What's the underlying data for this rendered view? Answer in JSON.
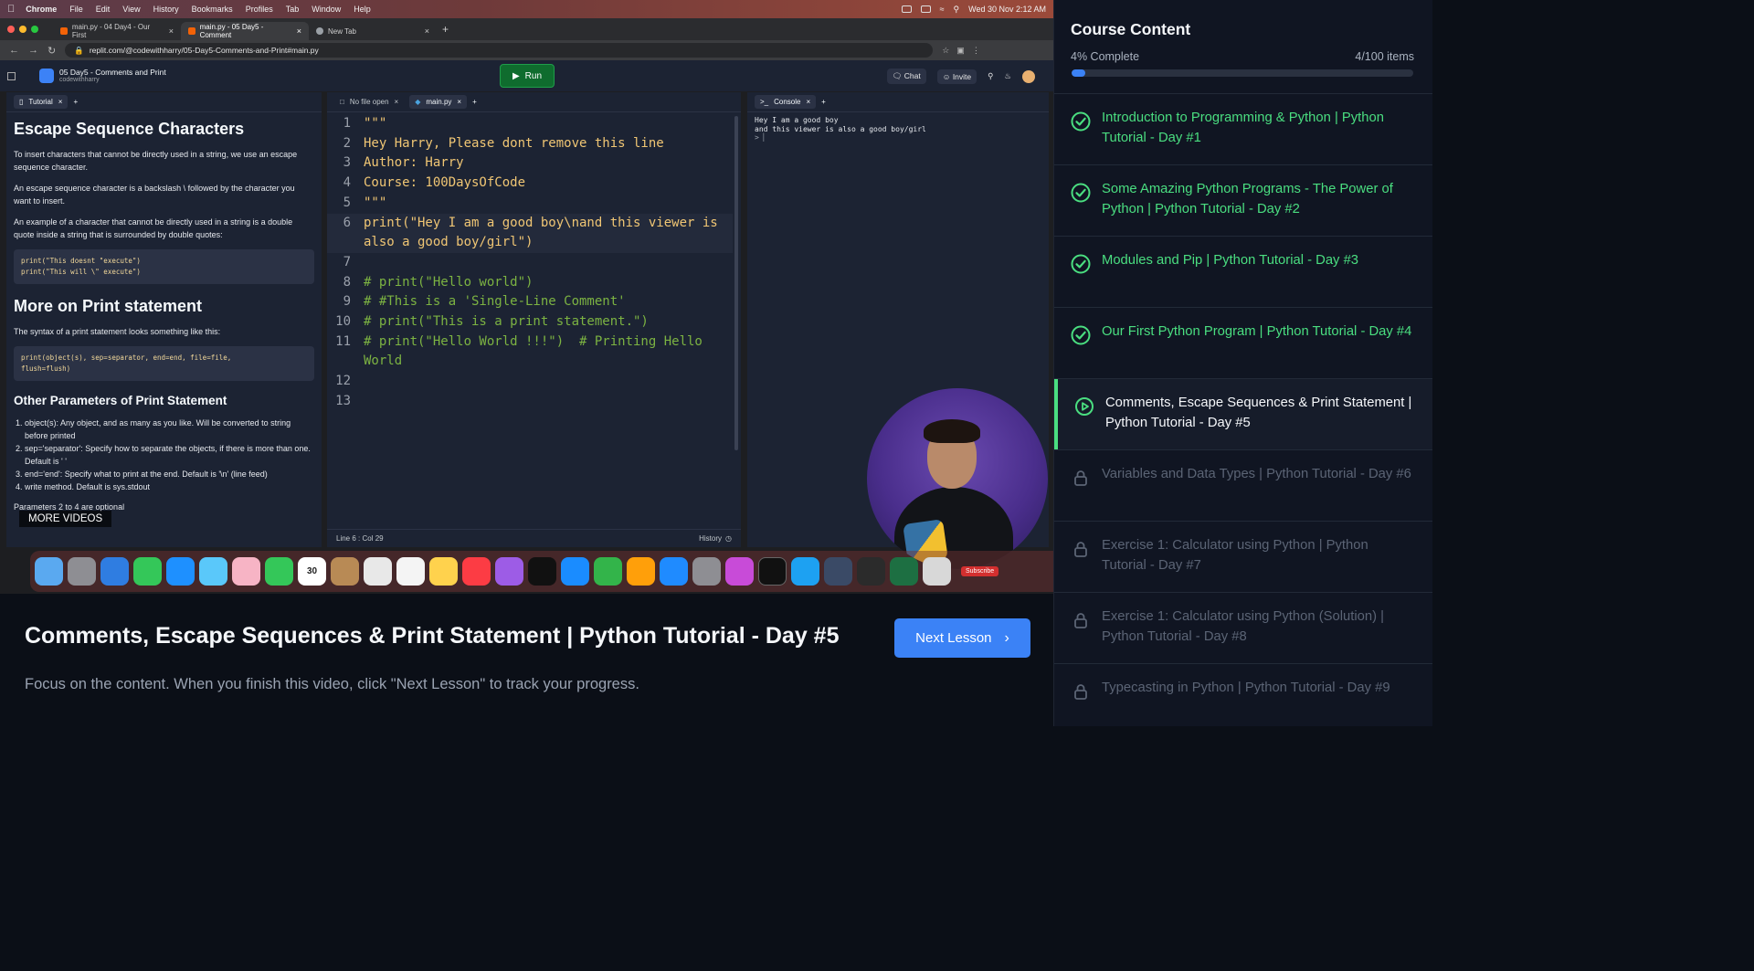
{
  "video": {
    "mac_menu": {
      "items": [
        "Chrome",
        "File",
        "Edit",
        "View",
        "History",
        "Bookmarks",
        "Profiles",
        "Tab",
        "Window",
        "Help"
      ],
      "clock": "Wed 30 Nov  2:12 AM"
    },
    "browser": {
      "tabs": [
        {
          "label": "main.py - 04 Day4 - Our First"
        },
        {
          "label": "main.py - 05 Day5 - Comment"
        },
        {
          "label": "New Tab"
        }
      ],
      "url": "replit.com/@codewithharry/05-Day5-Comments-and-Print#main.py"
    },
    "replit": {
      "repl_title": "05 Day5 - Comments and Print",
      "repl_owner": "codewithharry",
      "run_label": "Run",
      "chat_label": "Chat",
      "invite_label": "Invite",
      "tutorial_tab": "Tutorial",
      "no_file_tab": "No file open",
      "main_tab": "main.py",
      "console_tab": "Console",
      "tutorial": {
        "h_escape": "Escape Sequence Characters",
        "p1": "To insert characters that cannot be directly used in a string, we use an escape sequence character.",
        "p2": "An escape sequence character is a backslash \\ followed by the character you want to insert.",
        "p3": "An example of a character that cannot be directly used in a string is a double quote inside a string that is surrounded by double quotes:",
        "code1_l1": "print(\"This doesnt \"execute\")",
        "code1_l2": "print(\"This will \\\" execute\")",
        "h_print": "More on Print statement",
        "p4": "The syntax of a print statement looks something like this:",
        "code2_l1": "print(object(s), sep=separator, end=end, file=file,",
        "code2_l2": "flush=flush)",
        "h_other": "Other Parameters of Print Statement",
        "li1": "object(s): Any object, and as many as you like. Will be converted to string before printed",
        "li2": "sep='separator': Specify how to separate the objects, if there is more than one. Default is ' '",
        "li3": "end='end': Specify what to print at the end. Default is '\\n' (line feed)",
        "li4": "write method. Default is sys.stdout",
        "p5": "Parameters 2 to 4 are optional",
        "more_videos": "MORE VIDEOS"
      },
      "code_lines": [
        {
          "n": "1",
          "t": "\"\"\""
        },
        {
          "n": "2",
          "t": "Hey Harry, Please dont remove this line"
        },
        {
          "n": "3",
          "t": "Author: Harry"
        },
        {
          "n": "4",
          "t": "Course: 100DaysOfCode"
        },
        {
          "n": "5",
          "t": "\"\"\""
        },
        {
          "n": "6",
          "t": "print(\"Hey I am a good boy\\nand this viewer is also a good boy/girl\")"
        },
        {
          "n": "7",
          "t": ""
        },
        {
          "n": "8",
          "t": "# print(\"Hello world\")"
        },
        {
          "n": "9",
          "t": "# #This is a 'Single-Line Comment'"
        },
        {
          "n": "10",
          "t": "# print(\"This is a print statement.\")"
        },
        {
          "n": "11",
          "t": "# print(\"Hello World !!!\")  # Printing Hello World"
        },
        {
          "n": "12",
          "t": ""
        },
        {
          "n": "13",
          "t": ""
        }
      ],
      "cursor_status": "Line 6 : Col 29",
      "history_label": "History",
      "console_lines": [
        "Hey I am a good boy",
        "and this viewer is also a good boy/girl",
        "> ▏"
      ]
    },
    "dock_calendar_day": "30",
    "subscribe_label": "Subscribe"
  },
  "lesson": {
    "title": "Comments, Escape Sequences & Print Statement | Python Tutorial - Day #5",
    "next_label": "Next Lesson",
    "hint": "Focus on the content. When you finish this video, click \"Next Lesson\" to track your progress."
  },
  "sidebar": {
    "title": "Course Content",
    "progress_label": "4% Complete",
    "progress_count": "4/100 items",
    "progress_fraction": 0.04,
    "lessons": [
      {
        "title": "Introduction to Programming & Python | Python Tutorial - Day #1",
        "state": "done"
      },
      {
        "title": "Some Amazing Python Programs - The Power of Python | Python Tutorial - Day #2",
        "state": "done"
      },
      {
        "title": "Modules and Pip | Python Tutorial - Day #3",
        "state": "done"
      },
      {
        "title": "Our First Python Program | Python Tutorial - Day #4",
        "state": "done"
      },
      {
        "title": "Comments, Escape Sequences & Print Statement | Python Tutorial - Day #5",
        "state": "current"
      },
      {
        "title": "Variables and Data Types | Python Tutorial - Day #6",
        "state": "locked"
      },
      {
        "title": "Exercise 1: Calculator using Python | Python Tutorial - Day #7",
        "state": "locked"
      },
      {
        "title": "Exercise 1: Calculator using Python (Solution) | Python Tutorial - Day #8",
        "state": "locked"
      },
      {
        "title": "Typecasting in Python | Python Tutorial - Day #9",
        "state": "locked"
      }
    ]
  },
  "colors": {
    "accent": "#3b82f6",
    "done_green": "#4ade80",
    "locked_gray": "#5b6475"
  }
}
